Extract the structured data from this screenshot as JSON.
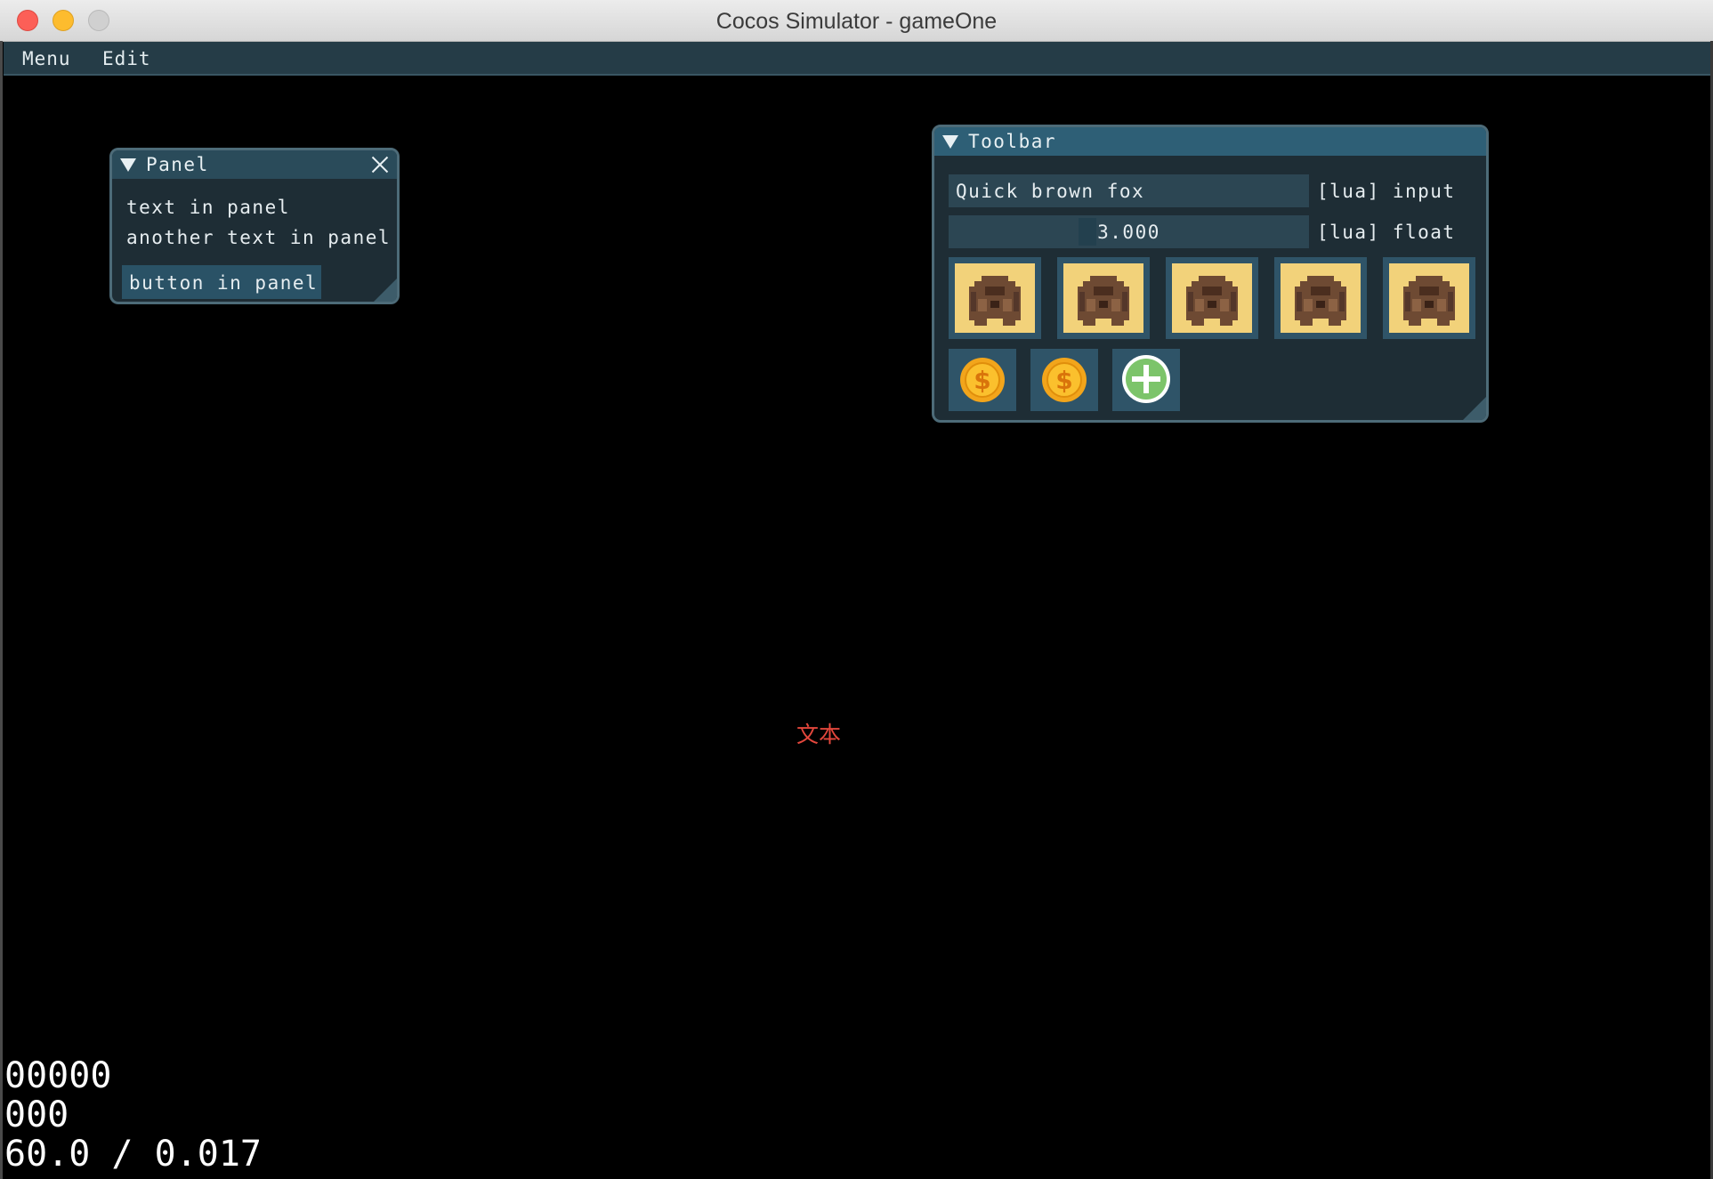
{
  "window": {
    "title": "Cocos Simulator - gameOne"
  },
  "menubar": {
    "items": [
      {
        "label": "Menu"
      },
      {
        "label": "Edit"
      }
    ]
  },
  "panel": {
    "title": "Panel",
    "text_1": "text in panel",
    "text_2": "another text in panel",
    "button_label": "button in panel"
  },
  "toolbar": {
    "title": "Toolbar",
    "input_value": "Quick brown fox",
    "input_label": "[lua] input",
    "float_value": "3.000",
    "float_label": "[lua] float",
    "image_buttons": [
      "backpack-icon",
      "backpack-icon",
      "backpack-icon",
      "backpack-icon",
      "backpack-icon"
    ],
    "small_buttons": [
      "coin-icon",
      "coin-icon",
      "plus-icon"
    ]
  },
  "scene": {
    "label": "文本",
    "label_color": "#e3473c"
  },
  "stats": {
    "line_1": "00000",
    "line_2": "000",
    "line_3": "60.0 / 0.017"
  },
  "colors": {
    "menubar": "#253c47",
    "imgui_window_bg": "#1e2d35",
    "imgui_title_active": "#2e5f76",
    "imgui_button": "#2f5468",
    "close_traffic": "#fc5f57",
    "minimize_traffic": "#fdbc2e",
    "zoom_traffic": "#d0d0d0"
  }
}
